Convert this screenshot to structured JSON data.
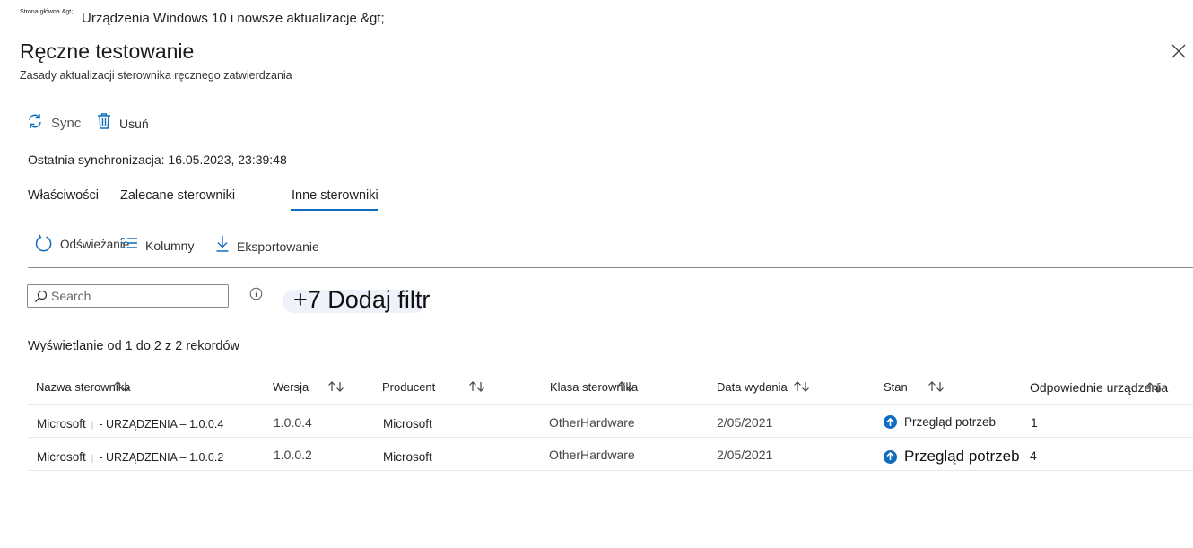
{
  "breadcrumb": {
    "home": "Strona główna &gt;",
    "current": "Urządzenia Windows 10 i nowsze aktualizacje &gt;"
  },
  "header": {
    "title": "Ręczne testowanie",
    "subtitle": "Zasady aktualizacji sterownika ręcznego zatwierdzania"
  },
  "toolbar": {
    "sync_label": "Sync",
    "delete_label": "Usuń"
  },
  "last_sync": "Ostatnia synchronizacja: 16.05.2023, 23:39:48",
  "tabs": [
    {
      "label": "Właściwości"
    },
    {
      "label": "Zalecane sterowniki"
    },
    {
      "label": "Inne sterowniki",
      "active": true
    }
  ],
  "list_toolbar": {
    "refresh_label": "Odświeżanie",
    "columns_label": "Kolumny",
    "export_label": "Eksportowanie"
  },
  "search": {
    "placeholder": "Search",
    "value": ""
  },
  "filter": {
    "label": "+7 Dodaj filtr"
  },
  "records_text": "Wyświetlanie od 1 do 2 z 2 rekordów",
  "table": {
    "columns": [
      "Nazwa sterownika",
      "Wersja",
      "Producent",
      "Klasa sterownika",
      "Data wydania",
      "Stan",
      "Odpowiednie urządzenia"
    ],
    "rows": [
      {
        "name_vendor": "Microsoft",
        "name_device": "- URZĄDZENIA – 1.0.0.4",
        "version": "1.0.0.4",
        "manufacturer": "Microsoft",
        "class": "OtherHardware",
        "release_date": "2/05/2021",
        "status": "Przegląd potrzeb",
        "devices": "1"
      },
      {
        "name_vendor": "Microsoft",
        "name_device": "- URZĄDZENIA – 1.0.0.2",
        "version": "1.0.0.2",
        "manufacturer": "Microsoft",
        "class": "OtherHardware",
        "release_date": "2/05/2021",
        "status": "Przegląd potrzeb",
        "devices": "4"
      }
    ]
  },
  "colors": {
    "accent": "#0f6cbd",
    "divider": "#8a8a8a"
  },
  "icons": [
    "sync-icon",
    "trash-icon",
    "close-icon",
    "refresh-icon",
    "columns-icon",
    "download-icon",
    "search-icon",
    "info-icon",
    "sort-icon",
    "arrow-up-circle-icon"
  ]
}
